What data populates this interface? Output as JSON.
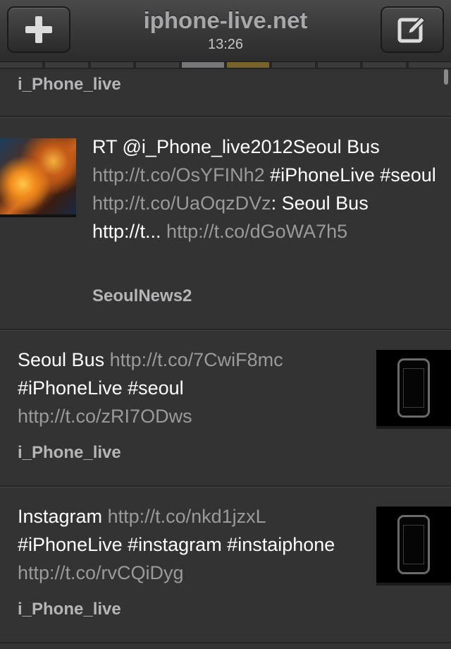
{
  "header": {
    "title": "iphone-live.net",
    "time": "13:26",
    "left_button_icon": "plus-icon",
    "right_button_icon": "compose-icon"
  },
  "pager": {
    "segments": 10,
    "active_index": 4
  },
  "timeline": [
    {
      "username": "i_Phone_live",
      "partial": true
    },
    {
      "parts": [
        {
          "t": "RT @i_Phone_live2012Seoul Bus ",
          "link": false
        },
        {
          "t": "http://t.co/OsYFINh2",
          "link": true
        },
        {
          "t": " #iPhoneLive #seoul ",
          "link": false
        },
        {
          "t": "http://t.co/UaOqzDVz",
          "link": true
        },
        {
          "t": ": Seoul Bus  http://t... ",
          "link": false
        },
        {
          "t": "http://t.co/dGoWA7h5",
          "link": true
        }
      ],
      "username": "SeoulNews2",
      "thumb": "left"
    },
    {
      "parts": [
        {
          "t": "Seoul Bus  ",
          "link": false
        },
        {
          "t": "http://t.co/7CwiF8mc",
          "link": true
        },
        {
          "t": " #iPhoneLive #seoul ",
          "link": false
        },
        {
          "t": "http://t.co/zRI7ODws",
          "link": true
        }
      ],
      "username": "i_Phone_live",
      "thumb": "right"
    },
    {
      "parts": [
        {
          "t": "Instagram  ",
          "link": false
        },
        {
          "t": "http://t.co/nkd1jzxL",
          "link": true
        },
        {
          "t": " #iPhoneLive #instagram #instaiphone ",
          "link": false
        },
        {
          "t": "http://t.co/rvCQiDyg",
          "link": true
        }
      ],
      "username": "i_Phone_live",
      "thumb": "right"
    }
  ]
}
